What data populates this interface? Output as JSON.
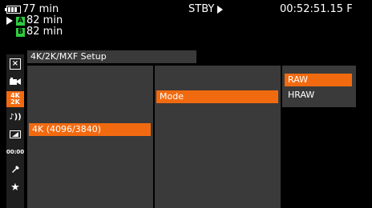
{
  "status": {
    "battery_time": "77 min",
    "slot_a_label": "A",
    "slot_a_time": "82 min",
    "slot_b_label": "B",
    "slot_b_time": "82 min",
    "mode": "STBY",
    "timecode": "00:52:51.15 F"
  },
  "sidebar": {
    "items": [
      {
        "icon": "close-icon",
        "label": "⊠"
      },
      {
        "icon": "camera-icon",
        "label": "▶▮"
      },
      {
        "icon": "4k2k-icon",
        "label": "4K 2K"
      },
      {
        "icon": "audio-icon",
        "label": "♪))"
      },
      {
        "icon": "lcd-icon",
        "label": "◩"
      },
      {
        "icon": "timecode-icon",
        "label": "00:00"
      },
      {
        "icon": "wrench-icon",
        "label": "✎"
      },
      {
        "icon": "star-icon",
        "label": "★"
      }
    ],
    "active_index": 2
  },
  "menu": {
    "title": "4K/2K/MXF Setup",
    "level1": {
      "item": "4K (4096/3840)"
    },
    "level2": {
      "item": "Mode"
    },
    "level3": {
      "options": [
        "RAW",
        "HRAW"
      ],
      "selected": "RAW"
    }
  },
  "colors": {
    "accent": "#f26a10",
    "panel": "#3a3a3a",
    "slot": "#2ecc40"
  }
}
